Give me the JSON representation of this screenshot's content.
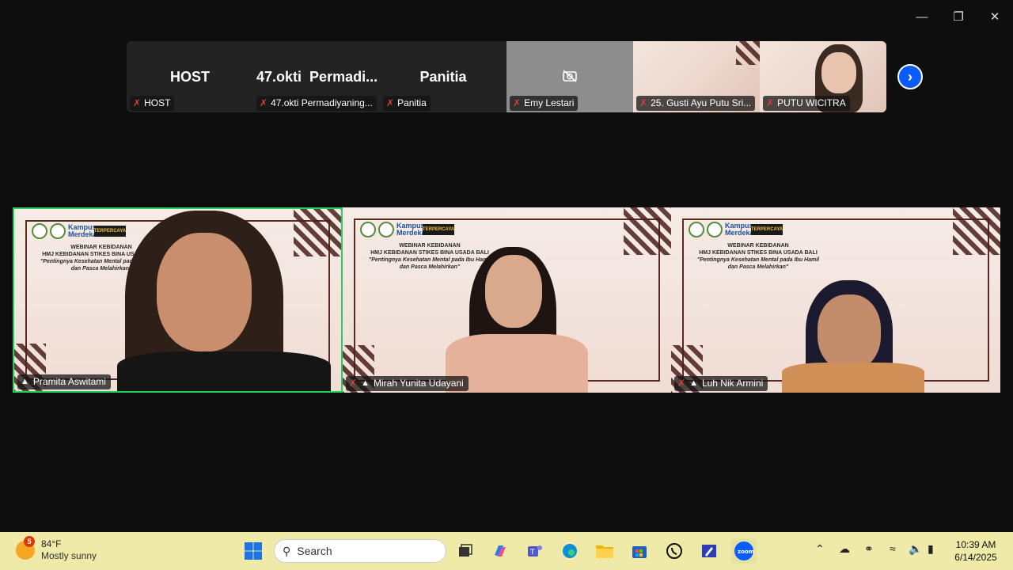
{
  "top_strip": {
    "tiles": [
      {
        "big": "HOST",
        "label": "HOST"
      },
      {
        "big": "47.okti",
        "label": "47.okti Permadiyaning..."
      },
      {
        "big": "Permadi...",
        "label": ""
      },
      {
        "big": "Panitia",
        "label": "Panitia"
      },
      {
        "label": "Emy Lestari"
      },
      {
        "label": "25. Gusti Ayu Putu Sri..."
      },
      {
        "label": "PUTU WICITRA"
      }
    ],
    "next_icon": "chevron-right-icon"
  },
  "slide": {
    "logo_text": "Kampus Merdeka",
    "banner": "TERPERCAYA",
    "line1": "WEBINAR KEBIDANAN",
    "line2": "HMJ KEBIDANAN STIKES BINA USADA BALI",
    "line3": "\"Pentingnya Kesehatan Mental pada Ibu Hamil dan Pasca Melahirkan\""
  },
  "gallery": [
    {
      "name": "Pramita Aswitami"
    },
    {
      "name": "Mirah Yunita Udayani"
    },
    {
      "name": "Luh Nik Armini"
    }
  ],
  "taskbar": {
    "weather_badge": "5",
    "temperature": "84°F",
    "condition": "Mostly sunny",
    "search_placeholder": "Search",
    "time": "10:39 AM",
    "date": "6/14/2025"
  }
}
